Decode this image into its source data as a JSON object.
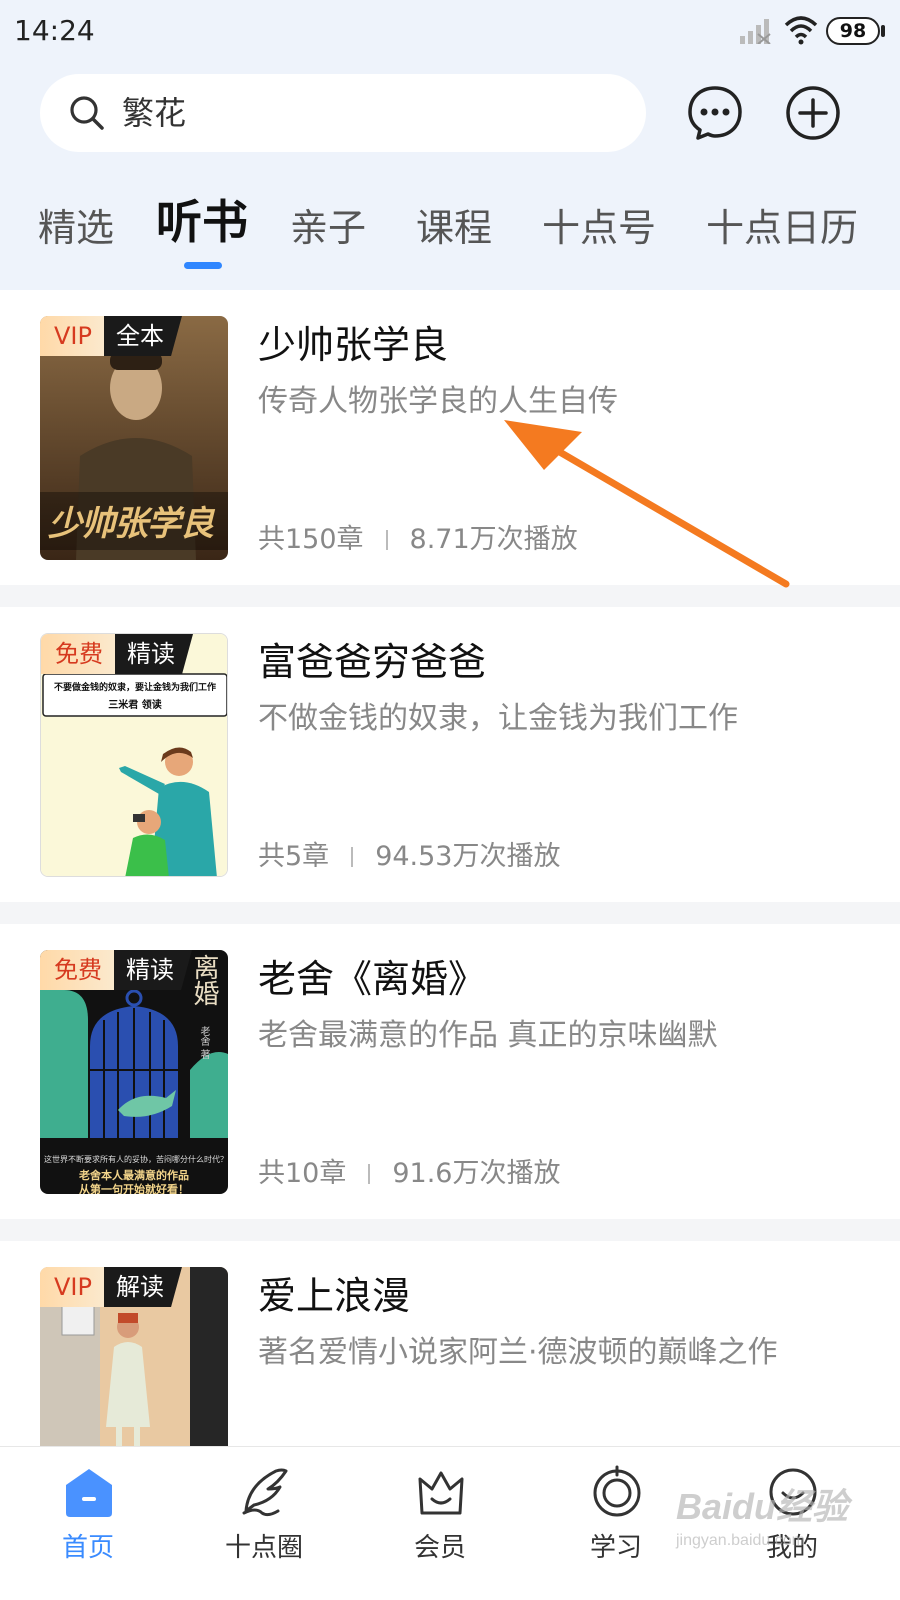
{
  "status_bar": {
    "time": "14:24",
    "battery": "98"
  },
  "search": {
    "query": "繁花"
  },
  "tabs": [
    {
      "label": "精选"
    },
    {
      "label": "听书"
    },
    {
      "label": "亲子"
    },
    {
      "label": "课程"
    },
    {
      "label": "十点号"
    },
    {
      "label": "十点日历"
    }
  ],
  "active_tab": "听书",
  "books": [
    {
      "badge_left": "VIP",
      "badge_right": "全本",
      "title": "少帅张学良",
      "description": "传奇人物张学良的人生自传",
      "chapters": "共150章",
      "plays": "8.71万次播放",
      "cover_title": "少帅张学良"
    },
    {
      "badge_left": "免费",
      "badge_right": "精读",
      "title": "富爸爸穷爸爸",
      "description": "不做金钱的奴隶，让金钱为我们工作",
      "chapters": "共5章",
      "plays": "94.53万次播放",
      "cover_line1": "不要做金钱的奴隶，要让金钱为我们工作",
      "cover_line2": "三米君 领读"
    },
    {
      "badge_left": "免费",
      "badge_right": "精读",
      "title": "老舍《离婚》",
      "description": "老舍最满意的作品 真正的京味幽默",
      "chapters": "共10章",
      "plays": "91.6万次播放",
      "cover_title": "离婚",
      "cover_author": "老舍 著",
      "cover_line1": "这世界不断要求所有人的妥协，苦闷哪分什么时代？",
      "cover_line2": "老舍本人最满意的作品",
      "cover_line3": "从第一句开始就好看！"
    },
    {
      "badge_left": "VIP",
      "badge_right": "解读",
      "title": "爱上浪漫",
      "description": "著名爱情小说家阿兰·德波顿的巅峰之作"
    }
  ],
  "bottom_nav": [
    {
      "label": "首页",
      "icon": "home-icon"
    },
    {
      "label": "十点圈",
      "icon": "feather-icon"
    },
    {
      "label": "会员",
      "icon": "crown-icon"
    },
    {
      "label": "学习",
      "icon": "target-icon"
    },
    {
      "label": "我的",
      "icon": "smiley-icon"
    }
  ],
  "watermark": {
    "main": "Baidu经验",
    "sub": "jingyan.baidu.com"
  },
  "colors": {
    "accent": "#2f86ff",
    "badge_red": "#d63a1f",
    "arrow": "#f47a20"
  }
}
